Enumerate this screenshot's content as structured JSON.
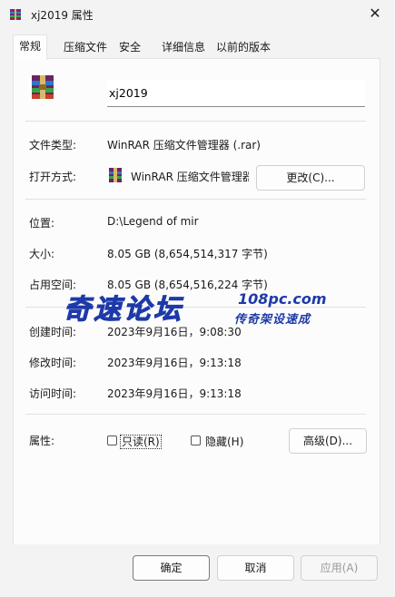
{
  "window": {
    "title": "xj2019 属性",
    "close_glyph": "✕"
  },
  "tabs": [
    "常规",
    "压缩文件",
    "安全",
    "详细信息",
    "以前的版本"
  ],
  "file": {
    "name": "xj2019",
    "icon": "winrar-archive-icon"
  },
  "rows": {
    "type_label": "文件类型:",
    "type_value": "WinRAR 压缩文件管理器 (.rar)",
    "open_label": "打开方式:",
    "open_value": "WinRAR 压缩文件管理器",
    "change_button": "更改(C)...",
    "location_label": "位置:",
    "location_value": "D:\\Legend of mir",
    "size_label": "大小:",
    "size_value": "8.05 GB (8,654,514,317 字节)",
    "disk_label": "占用空间:",
    "disk_value": "8.05 GB (8,654,516,224 字节)",
    "created_label": "创建时间:",
    "created_value": "2023年9月16日，9:08:30",
    "modified_label": "修改时间:",
    "modified_value": "2023年9月16日，9:13:18",
    "accessed_label": "访问时间:",
    "accessed_value": "2023年9月16日，9:13:18",
    "attributes_label": "属性:",
    "readonly_label": "只读(R)",
    "hidden_label": "隐藏(H)",
    "advanced_button": "高级(D)..."
  },
  "watermark": {
    "main": "奇速论坛",
    "site": "108pc.com",
    "sub": "传奇架设速成"
  },
  "buttons": {
    "ok": "确定",
    "cancel": "取消",
    "apply": "应用(A)"
  },
  "colors": {
    "watermark": "#1e3aa8"
  }
}
